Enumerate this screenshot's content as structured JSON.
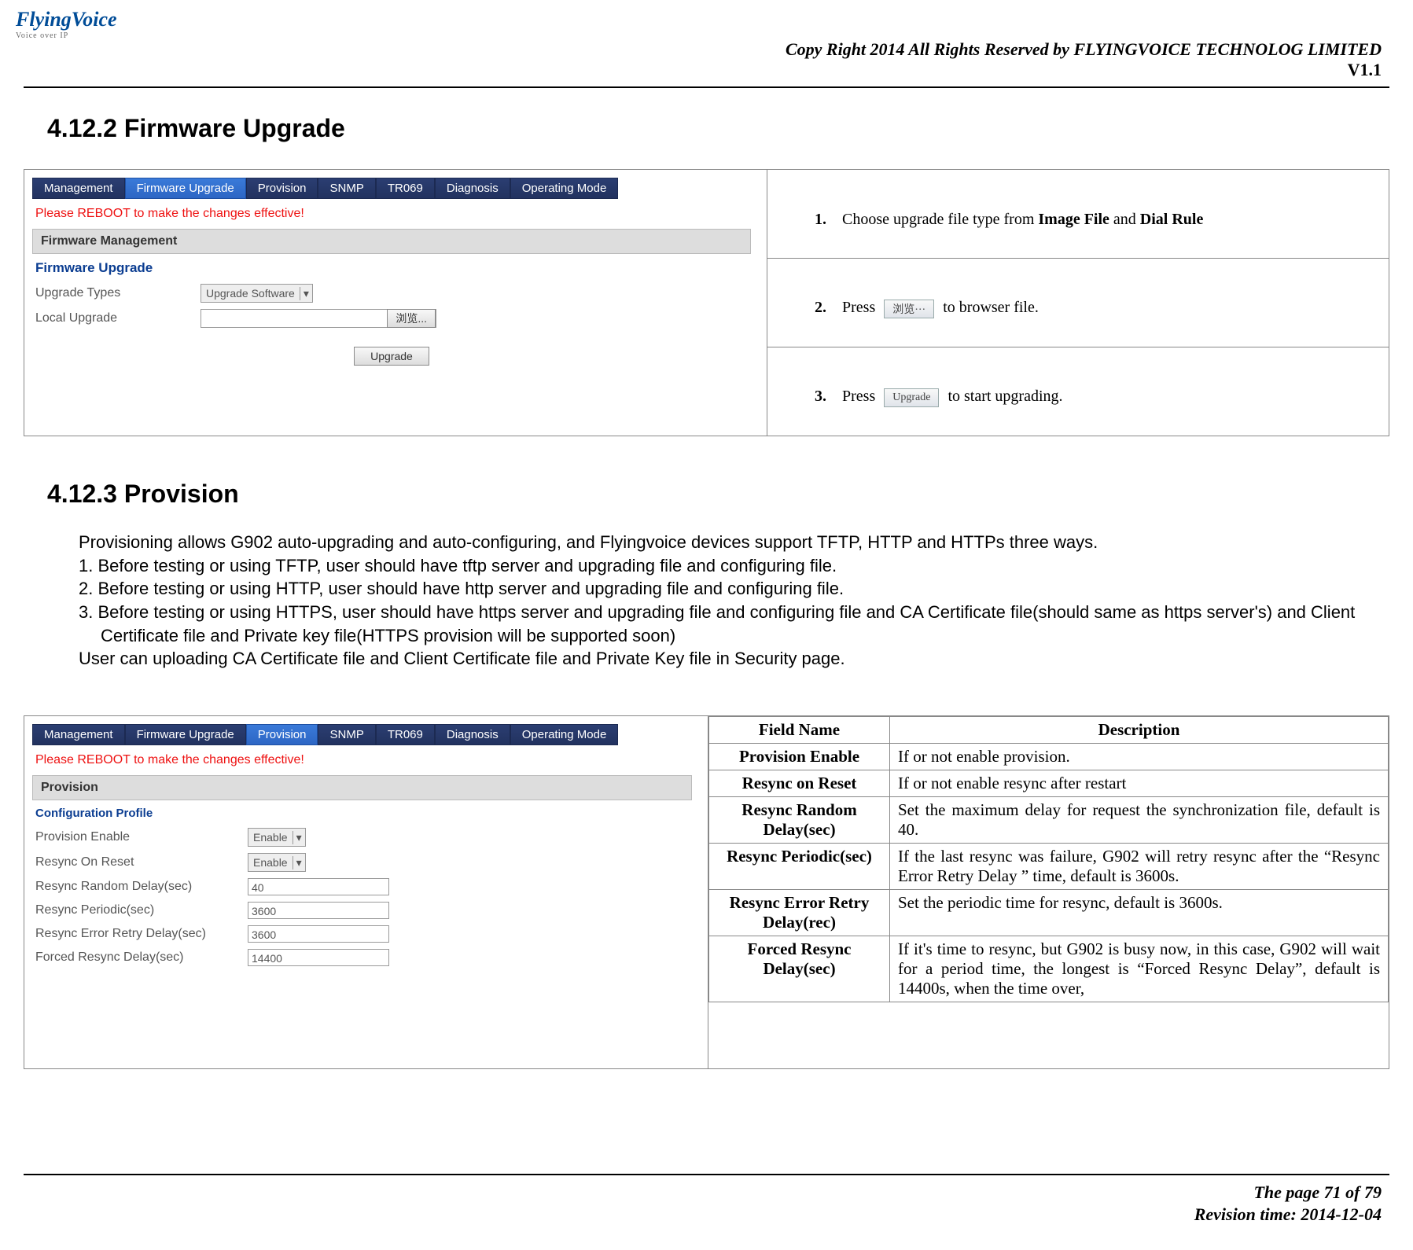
{
  "header": {
    "logo_main": "FlyingVoice",
    "logo_sub": "Voice over IP",
    "copy": "Copy Right 2014 All Rights Reserved by FLYINGVOICE TECHNOLOG LIMITED",
    "version": "V1.1"
  },
  "section_4122": {
    "title": "4.12.2  Firmware Upgrade",
    "tabs": {
      "management": "Management",
      "firmware": "Firmware Upgrade",
      "provision": "Provision",
      "snmp": "SNMP",
      "tr069": "TR069",
      "diagnosis": "Diagnosis",
      "opmode": "Operating Mode"
    },
    "warn": "Please REBOOT to make the changes effective!",
    "panel_title": "Firmware Management",
    "subhead": "Firmware Upgrade",
    "fields": {
      "upgrade_types_label": "Upgrade Types",
      "upgrade_types_value": "Upgrade Software",
      "local_upgrade_label": "Local Upgrade",
      "browse_btn": "浏览...",
      "upgrade_btn": "Upgrade"
    },
    "steps": {
      "s1_marker": "1.",
      "s1_a": "Choose upgrade file type from ",
      "s1_b": "Image File",
      "s1_c": " and ",
      "s1_d": "Dial Rule",
      "s2_marker": "2.",
      "s2_a": "Press ",
      "s2_btn": "浏览···",
      "s2_b": " to browser file.",
      "s3_marker": "3.",
      "s3_a": "Press ",
      "s3_btn": "Upgrade",
      "s3_b": "  to start upgrading."
    }
  },
  "section_4123": {
    "title": "4.12.3  Provision",
    "intro": "Provisioning allows G902 auto-upgrading and auto-configuring, and Flyingvoice devices support TFTP, HTTP and HTTPs three ways.",
    "p1": "1.  Before testing or using TFTP, user should have tftp server and upgrading file and configuring file.",
    "p2": "2.  Before testing or using HTTP, user should have http server and upgrading file and configuring file.",
    "p3": "3.  Before testing or using HTTPS, user should have https server and upgrading file and configuring file and CA Certificate file(should same as https server's) and Client Certificate file and Private key file(HTTPS provision will be supported soon)",
    "p4": "User can uploading CA Certificate file and Client Certificate file and Private Key file in Security page.",
    "tabs": {
      "management": "Management",
      "firmware": "Firmware Upgrade",
      "provision": "Provision",
      "snmp": "SNMP",
      "tr069": "TR069",
      "diagnosis": "Diagnosis",
      "opmode": "Operating Mode"
    },
    "warn": "Please REBOOT to make the changes effective!",
    "panel_title": "Provision",
    "subhead": "Configuration Profile",
    "form": {
      "provision_enable_label": "Provision Enable",
      "provision_enable_value": "Enable",
      "resync_on_reset_label": "Resync On Reset",
      "resync_on_reset_value": "Enable",
      "resync_random_label": "Resync Random Delay(sec)",
      "resync_random_value": "40",
      "resync_periodic_label": "Resync Periodic(sec)",
      "resync_periodic_value": "3600",
      "resync_err_label": "Resync Error Retry Delay(sec)",
      "resync_err_value": "3600",
      "forced_resync_label": "Forced Resync Delay(sec)",
      "forced_resync_value": "14400"
    },
    "desc_head": {
      "field": "Field Name",
      "desc": "Description"
    },
    "rows": [
      {
        "f": "Provision Enable",
        "d": "If or not enable provision."
      },
      {
        "f": "Resync on Reset",
        "d": "If or not enable resync after restart"
      },
      {
        "f": "Resync Random Delay(sec)",
        "d": "Set the maximum delay for request the synchronization file, default is 40."
      },
      {
        "f": "Resync Periodic(sec)",
        "d": "If the last resync was failure, G902 will retry resync after the “Resync Error Retry Delay ” time, default is 3600s."
      },
      {
        "f": "Resync Error Retry Delay(rec)",
        "d": "Set the periodic time for resync, default is 3600s."
      },
      {
        "f": "Forced Resync Delay(sec)",
        "d": "If it's time to resync, but G902 is busy now, in this case, G902 will wait for a period time, the longest is “Forced Resync Delay”, default is 14400s, when the time over,"
      }
    ]
  },
  "footer": {
    "page": "The page 71 of 79",
    "rev": "Revision time: 2014-12-04"
  }
}
